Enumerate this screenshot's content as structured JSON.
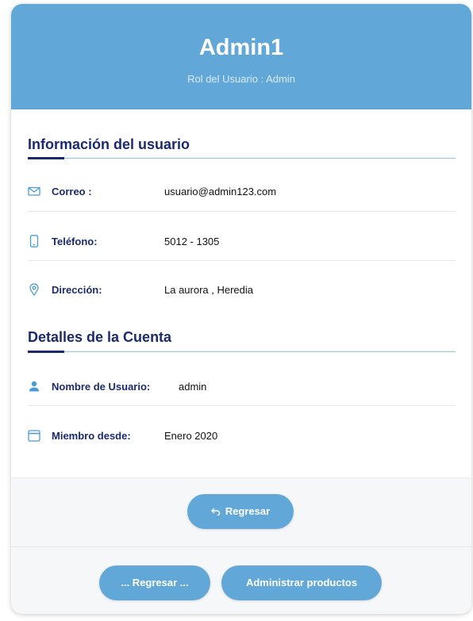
{
  "header": {
    "title": "Admin1",
    "role": "Rol del Usuario : Admin",
    "color": "#61a8d9"
  },
  "sections": {
    "user_info": {
      "title": "Información del usuario",
      "email": {
        "icon": "mail-icon",
        "label": "Correo :",
        "value": "usuario@admin123.com"
      },
      "phone": {
        "icon": "phone-icon",
        "label": "Teléfono:",
        "value": "5012 - 1305"
      },
      "address": {
        "icon": "location-pin-icon",
        "label": "Dirección:",
        "value": "La aurora , Heredia"
      }
    },
    "account": {
      "title": "Detalles de la Cuenta",
      "username": {
        "icon": "user-icon",
        "label": "Nombre de Usuario:",
        "value": "admin"
      },
      "member_since": {
        "icon": "calendar-icon",
        "label": "Miembro desde:",
        "value": "Enero 2020"
      }
    }
  },
  "buttons": {
    "back": {
      "icon": "undo-arrow-icon",
      "label": "Regresar"
    },
    "back_alt": {
      "label": "... Regresar ..."
    },
    "manage_products": {
      "label": "Administrar productos"
    }
  },
  "colors": {
    "accent": "#61a8d9",
    "heading": "#1b2a6e",
    "icon": "#4a9bd4"
  }
}
